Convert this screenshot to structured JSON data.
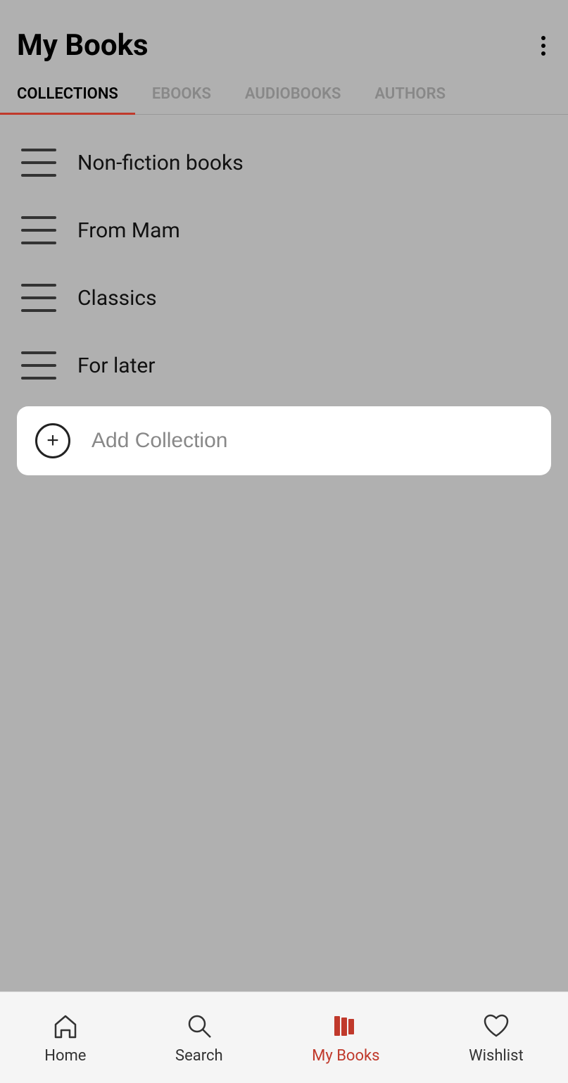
{
  "header": {
    "title": "My Books",
    "menu_icon_label": "more options"
  },
  "tabs": [
    {
      "id": "collections",
      "label": "COLLECTIONS",
      "active": true
    },
    {
      "id": "ebooks",
      "label": "EBOOKS",
      "active": false
    },
    {
      "id": "audiobooks",
      "label": "AUDIOBOOKS",
      "active": false
    },
    {
      "id": "authors",
      "label": "AUTHORS",
      "active": false
    }
  ],
  "collections": [
    {
      "id": 1,
      "label": "Non-fiction books"
    },
    {
      "id": 2,
      "label": "From Mam"
    },
    {
      "id": 3,
      "label": "Classics"
    },
    {
      "id": 4,
      "label": "For later"
    }
  ],
  "add_collection": {
    "label": "Add Collection"
  },
  "bottom_nav": [
    {
      "id": "home",
      "label": "Home",
      "active": false,
      "icon": "home-icon"
    },
    {
      "id": "search",
      "label": "Search",
      "active": false,
      "icon": "search-icon"
    },
    {
      "id": "mybooks",
      "label": "My Books",
      "active": true,
      "icon": "mybooks-icon"
    },
    {
      "id": "wishlist",
      "label": "Wishlist",
      "active": false,
      "icon": "wishlist-icon"
    }
  ],
  "colors": {
    "active_tab_underline": "#c0392b",
    "active_nav_label": "#c0392b",
    "background": "#b0b0b0"
  }
}
